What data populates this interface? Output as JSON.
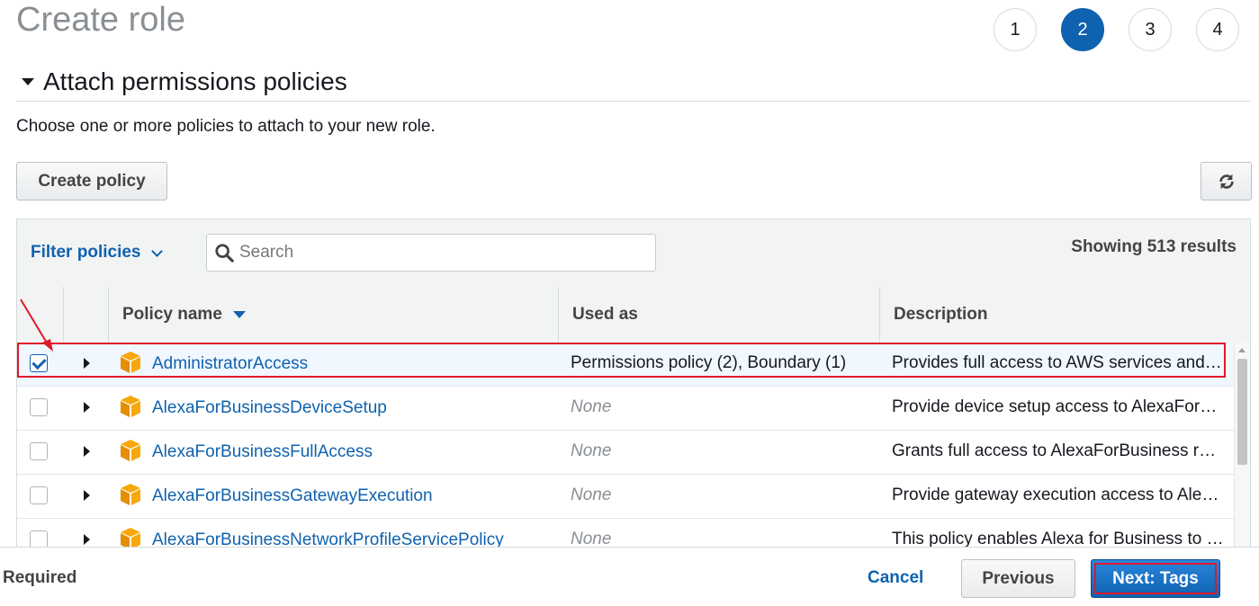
{
  "page_title": "Create role",
  "steps": [
    {
      "label": "1"
    },
    {
      "label": "2"
    },
    {
      "label": "3"
    },
    {
      "label": "4"
    }
  ],
  "active_step": 2,
  "section_title": "Attach permissions policies",
  "intro_text": "Choose one or more policies to attach to your new role.",
  "create_policy_label": "Create policy",
  "toolbar": {
    "filter_label": "Filter policies",
    "search_placeholder": "Search",
    "results_text": "Showing 513 results"
  },
  "columns": {
    "policy_name": "Policy name",
    "used_as": "Used as",
    "description": "Description"
  },
  "rows": [
    {
      "name": "AdministratorAccess",
      "used_as": "Permissions policy (2), Boundary (1)",
      "description": "Provides full access to AWS services and resources.",
      "checked": true
    },
    {
      "name": "AlexaForBusinessDeviceSetup",
      "used_as": "None",
      "description": "Provide device setup access to AlexaForBusiness services",
      "checked": false
    },
    {
      "name": "AlexaForBusinessFullAccess",
      "used_as": "None",
      "description": "Grants full access to AlexaForBusiness resources",
      "checked": false
    },
    {
      "name": "AlexaForBusinessGatewayExecution",
      "used_as": "None",
      "description": "Provide gateway execution access to AlexaForBusiness services",
      "checked": false
    },
    {
      "name": "AlexaForBusinessNetworkProfileServicePolicy",
      "used_as": "None",
      "description": "This policy enables Alexa for Business to perform automated tasks",
      "checked": false
    }
  ],
  "footer": {
    "required_label": "Required",
    "cancel_label": "Cancel",
    "previous_label": "Previous",
    "next_label": "Next: Tags"
  },
  "colors": {
    "accent": "#0f62af",
    "annotation": "#e0192a",
    "icon_orange": "#f7a70a"
  }
}
